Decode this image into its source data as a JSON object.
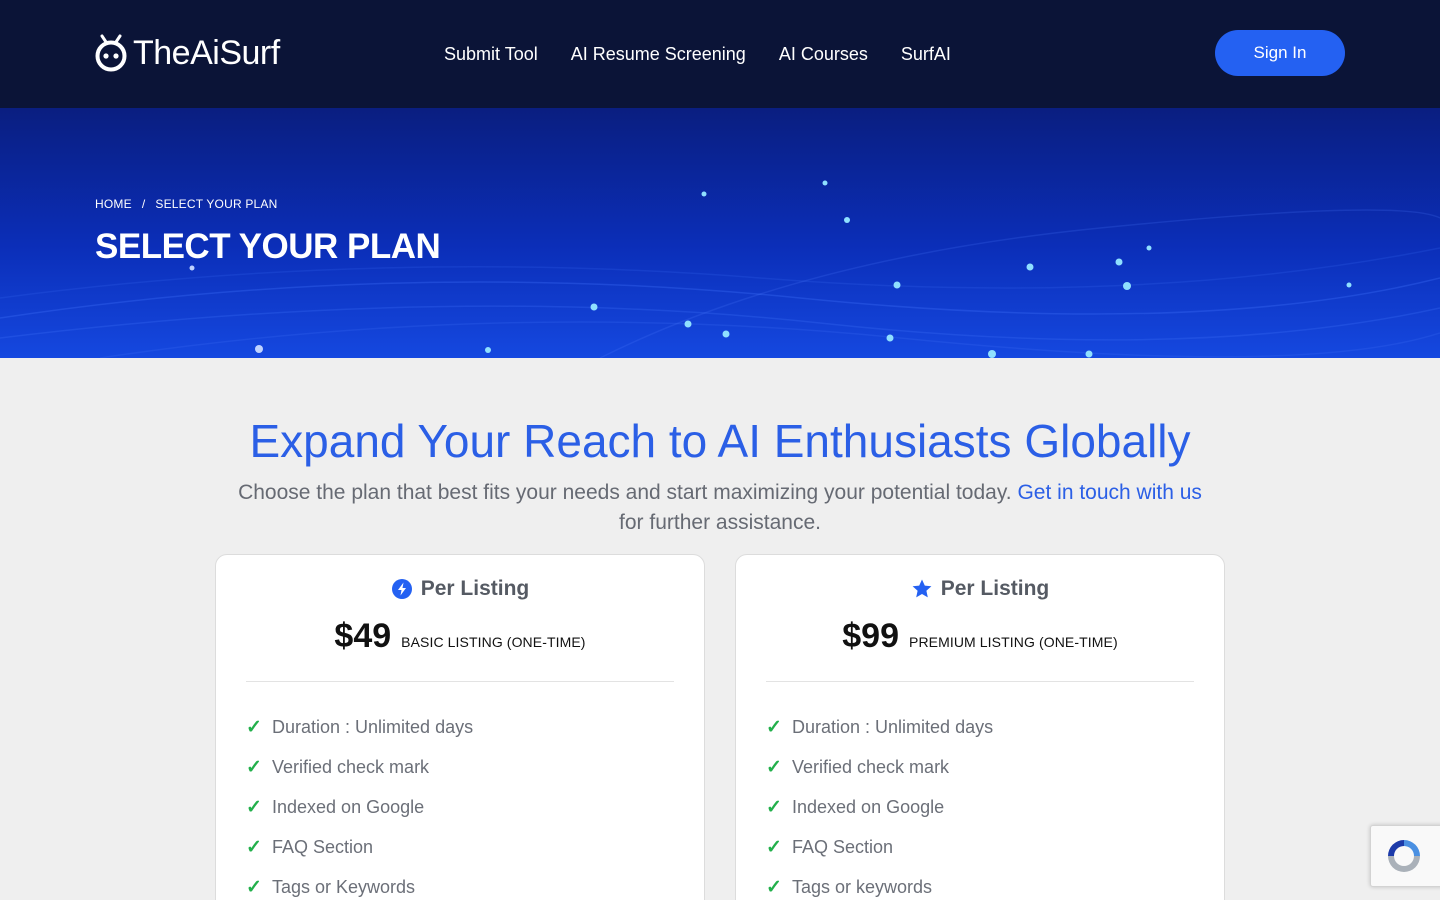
{
  "header": {
    "logo_text": "TheAiSurf",
    "nav": [
      "Submit Tool",
      "AI Resume Screening",
      "AI Courses",
      "SurfAI"
    ],
    "signin_label": "Sign In",
    "accent_color": "#2461f2",
    "background_color": "#0b1437"
  },
  "hero": {
    "breadcrumb": {
      "home": "HOME",
      "separator": "/",
      "current": "SELECT YOUR PLAN"
    },
    "title": "SELECT YOUR PLAN"
  },
  "main": {
    "headline": "Expand Your Reach to AI Enthusiasts Globally",
    "subtext": "Choose the plan that best fits your needs and start maximizing your potential today.",
    "contact_link": "Get in touch with us",
    "subtext_tail": "for further assistance."
  },
  "plans": [
    {
      "icon": "lightning-icon",
      "label": "Per Listing",
      "price": "$49",
      "price_note": "BASIC LISTING (ONE-TIME)",
      "features": [
        "Duration : Unlimited days",
        "Verified check mark",
        "Indexed on Google",
        "FAQ Section",
        "Tags or Keywords"
      ]
    },
    {
      "icon": "star-icon",
      "label": "Per Listing",
      "price": "$99",
      "price_note": "PREMIUM LISTING (ONE-TIME)",
      "features": [
        "Duration : Unlimited days",
        "Verified check mark",
        "Indexed on Google",
        "FAQ Section",
        "Tags or keywords"
      ]
    }
  ],
  "check_color": "#22b04b"
}
